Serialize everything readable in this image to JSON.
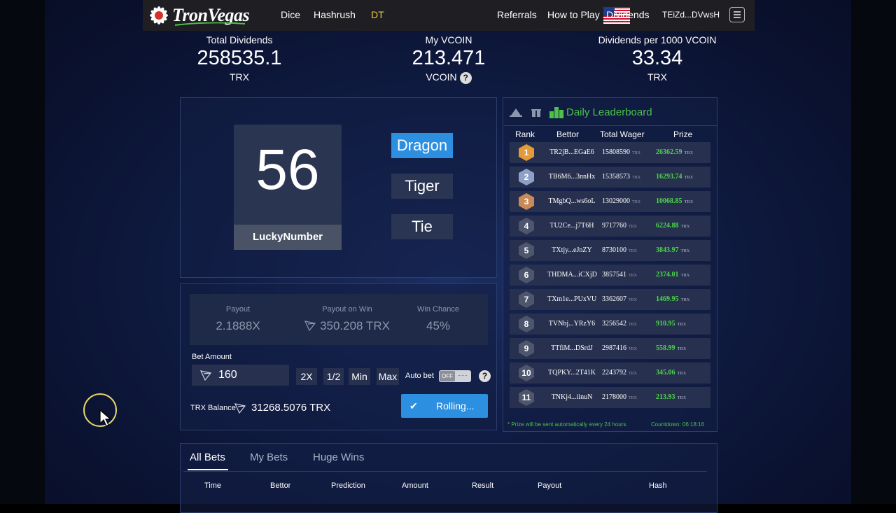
{
  "header": {
    "logo_text": "TronVegas",
    "nav": [
      "Dice",
      "Hashrush",
      "DT"
    ],
    "nav_right": [
      "Referrals",
      "How to Play",
      "Dividends"
    ],
    "account": "TEiZd...DVwsH",
    "flag_icon": "us-flag-icon",
    "menu_icon": "menu-list-icon"
  },
  "stats": {
    "total_dividends_label": "Total Dividends",
    "total_dividends_value": "258535.1",
    "total_dividends_unit": "TRX",
    "my_vcoin_label": "My VCOIN",
    "my_vcoin_value": "213.471",
    "my_vcoin_unit": "VCOIN",
    "per_1000_label": "Dividends per 1000 VCOIN",
    "per_1000_value": "33.34",
    "per_1000_unit": "TRX",
    "help": "?"
  },
  "game": {
    "number": "56",
    "number_label": "LuckyNumber",
    "choices": [
      "Dragon",
      "Tiger",
      "Tie"
    ],
    "selected_choice": "Dragon"
  },
  "bet": {
    "payout_label": "Payout",
    "payout_value": "2.1888X",
    "payout_on_win_label": "Payout on Win",
    "payout_on_win_value": "350.208 TRX",
    "win_chance_label": "Win Chance",
    "win_chance_value": "45%",
    "bet_amount_label": "Bet Amount",
    "bet_amount_value": "160",
    "btn_2x": "2X",
    "btn_half": "1/2",
    "btn_min": "Min",
    "btn_max": "Max",
    "auto_bet_label": "Auto bet",
    "auto_bet_state": "OFF",
    "help": "?",
    "balance_label": "TRX Balance",
    "balance_value": "31268.5076 TRX",
    "roll_label": "Rolling..."
  },
  "leaderboard": {
    "title": "Daily Leaderboard",
    "columns": [
      "Rank",
      "Bettor",
      "Total Wager",
      "Prize"
    ],
    "unit": "TRX",
    "rows": [
      {
        "rank": "1",
        "bettor": "TR2jB...EGaE6",
        "wager": "15808590",
        "prize": "26362.59"
      },
      {
        "rank": "2",
        "bettor": "TB6M6...3nnHx",
        "wager": "15358573",
        "prize": "16293.74"
      },
      {
        "rank": "3",
        "bettor": "TMgbQ...ws6oL",
        "wager": "13029000",
        "prize": "10068.85"
      },
      {
        "rank": "4",
        "bettor": "TU2Ce...j7T6H",
        "wager": "9717760",
        "prize": "6224.88"
      },
      {
        "rank": "5",
        "bettor": "TXtjy...eJnZY",
        "wager": "8730100",
        "prize": "3843.97"
      },
      {
        "rank": "6",
        "bettor": "THDMA...iCXjD",
        "wager": "3857541",
        "prize": "2374.01"
      },
      {
        "rank": "7",
        "bettor": "TXm1e...PUxVU",
        "wager": "3362607",
        "prize": "1469.95"
      },
      {
        "rank": "8",
        "bettor": "TVNbj...YRzY6",
        "wager": "3256542",
        "prize": "910.95"
      },
      {
        "rank": "9",
        "bettor": "TTfiM...DSrdJ",
        "wager": "2987416",
        "prize": "558.99"
      },
      {
        "rank": "10",
        "bettor": "TQPKY...2T41K",
        "wager": "2243792",
        "prize": "345.06"
      },
      {
        "rank": "11",
        "bettor": "TNKj4...iinuN",
        "wager": "2178000",
        "prize": "213.93"
      }
    ],
    "footnote": "* Prize will be sent automatically every 24 hours.",
    "countdown": "Countdown: 06:18:16"
  },
  "bets_table": {
    "tabs": [
      "All Bets",
      "My Bets",
      "Huge Wins"
    ],
    "active_tab": "All Bets",
    "columns": [
      "Time",
      "Bettor",
      "Prediction",
      "Amount",
      "Result",
      "Payout",
      "Hash"
    ]
  },
  "colors": {
    "accent_blue": "#2d8fe0",
    "leaderboard_green": "#4cc24a",
    "prize_green": "#4cd64a",
    "active_nav": "#e8c84a"
  }
}
